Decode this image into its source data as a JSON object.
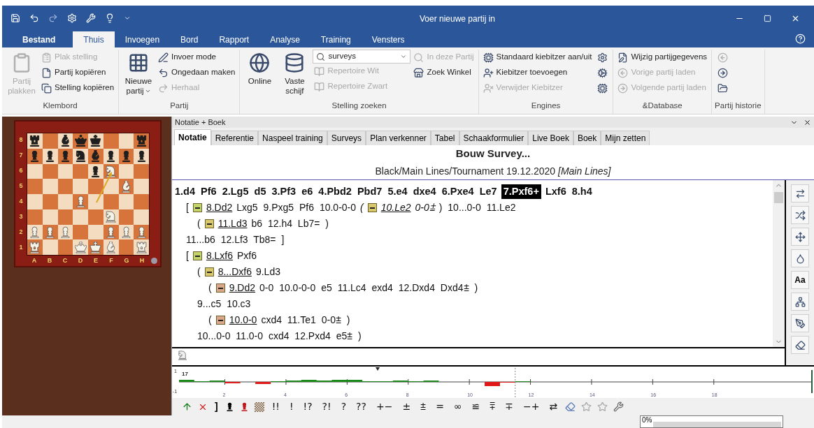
{
  "title_bar": {
    "title": "Voer nieuwe partij in"
  },
  "ribbon_tabs": [
    {
      "label": "Bestand",
      "kind": "file",
      "selected": false
    },
    {
      "label": "Thuis",
      "kind": "tab",
      "selected": true
    },
    {
      "label": "Invoegen",
      "kind": "tab",
      "selected": false
    },
    {
      "label": "Bord",
      "kind": "tab",
      "selected": false
    },
    {
      "label": "Rapport",
      "kind": "tab",
      "selected": false
    },
    {
      "label": "Analyse",
      "kind": "tab",
      "selected": false
    },
    {
      "label": "Training",
      "kind": "tab",
      "selected": false
    },
    {
      "label": "Vensters",
      "kind": "tab",
      "selected": false
    }
  ],
  "ribbon_groups": [
    {
      "label": "Klembord",
      "columns": [
        [
          {
            "kind": "large",
            "label": "Partij plakken",
            "disabled": true
          }
        ],
        [
          {
            "kind": "small",
            "label": "Plak stelling",
            "disabled": true
          },
          {
            "kind": "small",
            "label": "Partij kopiëren",
            "disabled": false
          },
          {
            "kind": "small",
            "label": "Stelling kopiëren",
            "disabled": false
          }
        ]
      ]
    },
    {
      "label": "Partij",
      "columns": [
        [
          {
            "kind": "large",
            "label": "Nieuwe partij",
            "disabled": false,
            "menu": true
          }
        ],
        [
          {
            "kind": "small",
            "label": "Invoer mode",
            "disabled": false
          },
          {
            "kind": "small",
            "label": "Ongedaan maken",
            "disabled": false
          },
          {
            "kind": "small",
            "label": "Herhaal",
            "disabled": true
          }
        ]
      ]
    },
    {
      "label": "Stelling zoeken",
      "columns": [
        [
          {
            "kind": "large",
            "label": "Online",
            "disabled": false
          }
        ],
        [
          {
            "kind": "large",
            "label": "Vaste schijf",
            "disabled": false
          }
        ],
        [
          {
            "kind": "combo",
            "value": "surveys"
          },
          {
            "kind": "small",
            "label": "Repertoire Wit",
            "disabled": true
          },
          {
            "kind": "small",
            "label": "Repertoire Zwart",
            "disabled": true
          }
        ],
        [
          {
            "kind": "small",
            "label": "In deze Partij",
            "disabled": true
          },
          {
            "kind": "small",
            "label": "Zoek Winkel",
            "disabled": false
          }
        ]
      ]
    },
    {
      "label": "Engines",
      "columns": [
        [
          {
            "kind": "small",
            "label": "Standaard kiebitzer aan/uit",
            "disabled": false
          },
          {
            "kind": "small",
            "label": "Kiebitzer toevoegen",
            "disabled": false
          },
          {
            "kind": "small",
            "label": "Verwijder Kiebitzer",
            "disabled": true
          }
        ],
        [
          {
            "kind": "icon",
            "disabled": false
          },
          {
            "kind": "icon",
            "disabled": false
          },
          {
            "kind": "icon",
            "disabled": false
          }
        ]
      ]
    },
    {
      "label": "&Database",
      "columns": [
        [
          {
            "kind": "small",
            "label": "Wijzig partijgegevens",
            "disabled": false
          },
          {
            "kind": "small",
            "label": "Vorige partij laden",
            "disabled": true
          },
          {
            "kind": "small",
            "label": "Volgende partij laden",
            "disabled": true
          }
        ]
      ]
    },
    {
      "label": "Partij historie",
      "columns": [
        [
          {
            "kind": "icon",
            "disabled": true
          },
          {
            "kind": "icon",
            "disabled": false
          },
          {
            "kind": "icon",
            "disabled": false
          }
        ]
      ]
    }
  ],
  "board": {
    "ranks": [
      [
        {
          "kind": "rook",
          "white": false
        },
        {
          "kind": "empty"
        },
        {
          "kind": "bishop",
          "white": false
        },
        {
          "kind": "queen",
          "white": false
        },
        {
          "kind": "king",
          "white": false
        },
        {
          "kind": "empty"
        },
        {
          "kind": "empty"
        },
        {
          "kind": "rook",
          "white": false
        }
      ],
      [
        {
          "kind": "pawn",
          "white": false
        },
        {
          "kind": "pawn",
          "white": false
        },
        {
          "kind": "pawn",
          "white": false
        },
        {
          "kind": "knight",
          "white": false
        },
        {
          "kind": "bishop",
          "white": false
        },
        {
          "kind": "pawn",
          "white": false
        },
        {
          "kind": "pawn",
          "white": false
        },
        {
          "kind": "pawn",
          "white": false
        }
      ],
      [
        {
          "kind": "empty"
        },
        {
          "kind": "empty"
        },
        {
          "kind": "empty"
        },
        {
          "kind": "empty"
        },
        {
          "kind": "pawn",
          "white": false
        },
        {
          "kind": "knight",
          "white": true,
          "arrow_end": true
        },
        {
          "kind": "empty"
        },
        {
          "kind": "empty"
        }
      ],
      [
        {
          "kind": "empty"
        },
        {
          "kind": "empty"
        },
        {
          "kind": "empty"
        },
        {
          "kind": "empty"
        },
        {
          "kind": "empty"
        },
        {
          "kind": "empty"
        },
        {
          "kind": "bishop",
          "white": true
        },
        {
          "kind": "empty"
        }
      ],
      [
        {
          "kind": "empty"
        },
        {
          "kind": "empty"
        },
        {
          "kind": "empty"
        },
        {
          "kind": "pawn",
          "white": true
        },
        {
          "kind": "empty",
          "arrow_start": true
        },
        {
          "kind": "empty"
        },
        {
          "kind": "empty"
        },
        {
          "kind": "empty"
        }
      ],
      [
        {
          "kind": "empty"
        },
        {
          "kind": "empty"
        },
        {
          "kind": "empty"
        },
        {
          "kind": "empty"
        },
        {
          "kind": "empty"
        },
        {
          "kind": "knight",
          "white": true
        },
        {
          "kind": "empty"
        },
        {
          "kind": "empty"
        }
      ],
      [
        {
          "kind": "pawn",
          "white": true
        },
        {
          "kind": "pawn",
          "white": true
        },
        {
          "kind": "pawn",
          "white": true
        },
        {
          "kind": "empty"
        },
        {
          "kind": "empty"
        },
        {
          "kind": "pawn",
          "white": true
        },
        {
          "kind": "pawn",
          "white": true
        },
        {
          "kind": "pawn",
          "white": true
        }
      ],
      [
        {
          "kind": "rook",
          "white": true
        },
        {
          "kind": "empty"
        },
        {
          "kind": "empty"
        },
        {
          "kind": "queen",
          "white": true
        },
        {
          "kind": "king",
          "white": true
        },
        {
          "kind": "bishop",
          "white": true
        },
        {
          "kind": "empty"
        },
        {
          "kind": "rook",
          "white": true
        }
      ]
    ],
    "rank_labels": [
      "8",
      "7",
      "6",
      "5",
      "4",
      "3",
      "2",
      "1"
    ],
    "file_labels": [
      "A",
      "B",
      "C",
      "D",
      "E",
      "F",
      "G",
      "H"
    ]
  },
  "panel": {
    "title": "Notatie + Boek",
    "tabs": [
      {
        "label": "Notatie",
        "selected": true
      },
      {
        "label": "Referentie",
        "selected": false
      },
      {
        "label": "Naspeel training",
        "selected": false
      },
      {
        "label": "Surveys",
        "selected": false
      },
      {
        "label": "Plan verkenner",
        "selected": false
      },
      {
        "label": "Tabel",
        "selected": false
      },
      {
        "label": "Schaakformulier",
        "selected": false
      },
      {
        "label": "Live Boek",
        "selected": false
      },
      {
        "label": "Boek",
        "selected": false
      },
      {
        "label": "Mijn zetten",
        "selected": false
      }
    ],
    "heading": "Bouw Survey...",
    "subheading": "Black/Main Lines/Tournament 19.12.2020 *[Main Lines]*"
  },
  "notation": {
    "lines": [
      {
        "main": true,
        "segments": [
          {
            "kind": "text",
            "text": "1.d4 Pf6 2.Lg5 d5 3.Pf3 e6 4.Pbd2 Pbd7 5.e4 dxe4 6.Pxe4 Le7"
          },
          {
            "kind": "move",
            "text": "7.Pxf6+",
            "selected": true
          },
          {
            "kind": "text",
            "text": "Lxf6 8.h4"
          }
        ],
        "children": [
          {
            "main": false,
            "segments": [
              {
                "kind": "text",
                "text": "["
              },
              {
                "kind": "marker",
                "color": "#c3d46a"
              },
              {
                "kind": "lead",
                "text": "8.Dd2"
              },
              {
                "kind": "text",
                "text": "Lxg5 9.Pxg5 Pf6 10.0-0-0"
              },
              {
                "kind": "comment",
                "text": "("
              },
              {
                "kind": "marker",
                "color": "#d9c86c"
              },
              {
                "kind": "comment_lead",
                "text": "10.Le2"
              },
              {
                "kind": "comment",
                "text": "0-0⩲"
              },
              {
                "kind": "text",
                "text": ") 10...0-0 11.Le2"
              }
            ],
            "children": [
              {
                "main": false,
                "segments": [
                  {
                    "kind": "text",
                    "text": "("
                  },
                  {
                    "kind": "marker",
                    "color": "#d9c86c"
                  },
                  {
                    "kind": "lead",
                    "text": "11.Ld3"
                  },
                  {
                    "kind": "text",
                    "text": "b6 12.h4 Lb7= )"
                  }
                ]
              }
            ]
          },
          {
            "main": false,
            "segments": [
              {
                "kind": "text",
                "text": "11...b6 12.Lf3 Tb8= ]"
              }
            ]
          },
          {
            "main": false,
            "segments": [
              {
                "kind": "text",
                "text": "["
              },
              {
                "kind": "marker",
                "color": "#c3d46a"
              },
              {
                "kind": "lead",
                "text": "8.Lxf6"
              },
              {
                "kind": "text",
                "text": "Pxf6"
              }
            ],
            "children": [
              {
                "main": false,
                "segments": [
                  {
                    "kind": "text",
                    "text": "("
                  },
                  {
                    "kind": "marker",
                    "color": "#d9c86c"
                  },
                  {
                    "kind": "lead",
                    "text": "8...Dxf6"
                  },
                  {
                    "kind": "text",
                    "text": "9.Ld3"
                  }
                ],
                "children": [
                  {
                    "main": false,
                    "segments": [
                      {
                        "kind": "text",
                        "text": "("
                      },
                      {
                        "kind": "marker",
                        "color": "#dba88e"
                      },
                      {
                        "kind": "lead",
                        "text": "9.Dd2"
                      },
                      {
                        "kind": "text",
                        "text": "0-0 10.0-0-0 e5 11.Lc4 exd4 12.Dxd4 Dxd4⩲ )"
                      }
                    ]
                  }
                ]
              },
              {
                "main": false,
                "segments": [
                  {
                    "kind": "text",
                    "text": "9...c5 10.c3"
                  }
                ],
                "children": [
                  {
                    "main": false,
                    "segments": [
                      {
                        "kind": "text",
                        "text": "("
                      },
                      {
                        "kind": "marker",
                        "color": "#dba88e"
                      },
                      {
                        "kind": "lead",
                        "text": "10.0-0"
                      },
                      {
                        "kind": "text",
                        "text": "cxd4 11.Te1 0-0⩲ )"
                      }
                    ]
                  }
                ]
              },
              {
                "main": false,
                "segments": [
                  {
                    "kind": "text",
                    "text": "10...0-0 11.0-0 cxd4 12.Pxd4 e5⩲ )"
                  }
                ]
              }
            ]
          }
        ]
      }
    ]
  },
  "side_toolbar": {
    "font_button": "Aa"
  },
  "evaluation_graph": {
    "y_labels": [
      "1",
      "-1"
    ],
    "x_labels": [
      "2",
      "4",
      "6",
      "8",
      "10",
      "12",
      "14",
      "16",
      "18"
    ],
    "depth": "17"
  },
  "symbol_bar": {
    "bracket": "]",
    "symbols": [
      "!!",
      "!",
      "!?",
      "?!",
      "?",
      "??",
      "+−",
      "±",
      "⩲",
      "=",
      "∞",
      "≌",
      "⩱",
      "∓",
      "−+",
      "⇄"
    ]
  },
  "status_bar": {
    "progress": {
      "label": "0%",
      "level": 0
    }
  }
}
